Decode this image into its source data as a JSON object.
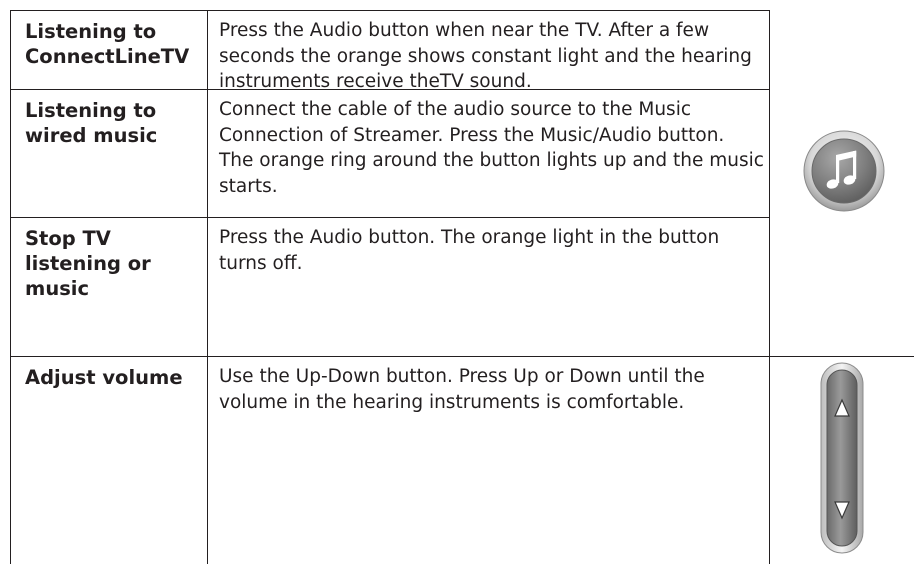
{
  "rows": [
    {
      "label": "Listening to ConnectLineTV",
      "description": "Press the Audio button when near the TV. After a few seconds the orange shows constant light and the hearing instruments receive theTV sound."
    },
    {
      "label": "Listening to wired music",
      "description": "Connect the cable of the audio source to the Music Connection of Streamer. Press the Music/Audio button. The orange ring around the button lights up and the music starts."
    },
    {
      "label": "Stop TV listening or music",
      "description": "Press the Audio button. The orange light in the button turns off."
    },
    {
      "label": "Adjust volume",
      "description": "Use the Up-Down button. Press Up or Down until the volume in the hearing instruments is comfortable."
    }
  ],
  "icons": {
    "music": "music-note-button-icon",
    "volume": "up-down-volume-button-icon"
  },
  "colors": {
    "text": "#231f20",
    "button_gray": "#7a7a7a"
  }
}
